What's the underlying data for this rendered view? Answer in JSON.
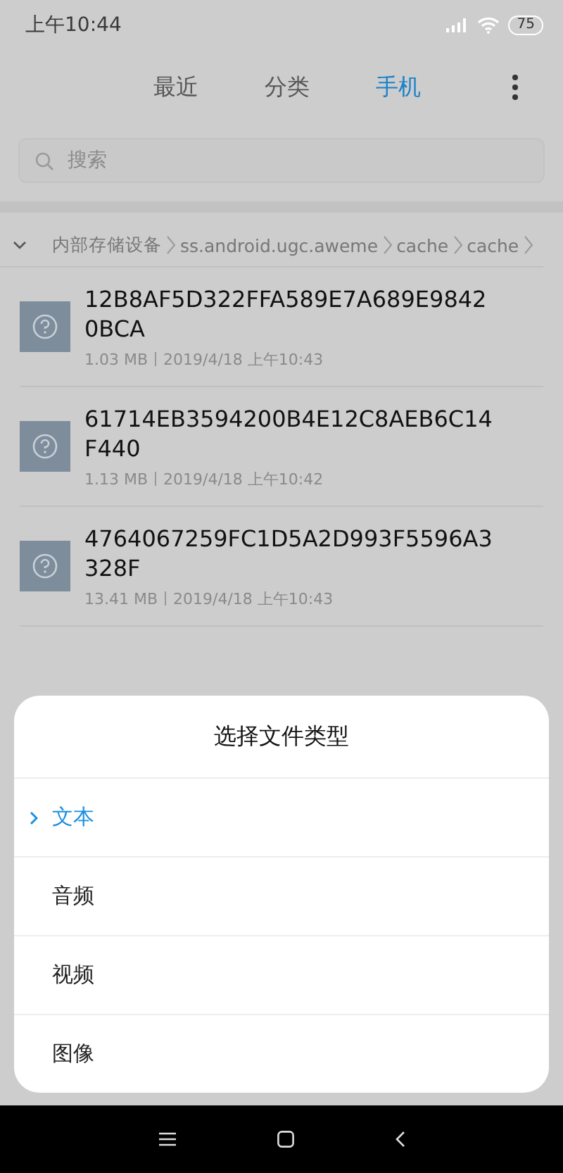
{
  "status_bar": {
    "time": "上午10:44",
    "battery": "75"
  },
  "tabs": [
    {
      "label": "最近",
      "selected": false
    },
    {
      "label": "分类",
      "selected": false
    },
    {
      "label": "手机",
      "selected": true
    }
  ],
  "search": {
    "placeholder": "搜索"
  },
  "breadcrumb": [
    "内部存储设备",
    "ss.android.ugc.aweme",
    "cache",
    "cache"
  ],
  "files": [
    {
      "name": "12B8AF5D322FFA589E7A689E98420BCA",
      "size": "1.03 MB",
      "date": "2019/4/18 上午10:43"
    },
    {
      "name": "61714EB3594200B4E12C8AEB6C14F440",
      "size": "1.13 MB",
      "date": "2019/4/18 上午10:42"
    },
    {
      "name": "4764067259FC1D5A2D993F5596A3328F",
      "size": "13.41 MB",
      "date": "2019/4/18 上午10:43"
    }
  ],
  "dialog": {
    "title": "选择文件类型",
    "options": [
      {
        "label": "文本",
        "selected": true
      },
      {
        "label": "音频",
        "selected": false
      },
      {
        "label": "视频",
        "selected": false
      },
      {
        "label": "图像",
        "selected": false
      }
    ]
  }
}
